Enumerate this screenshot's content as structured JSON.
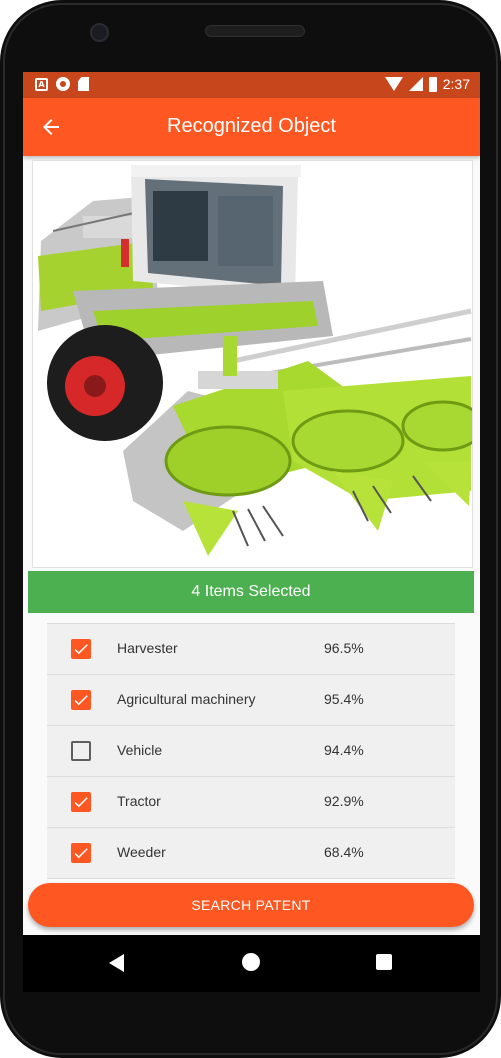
{
  "status_bar": {
    "time": "2:37",
    "icons": [
      "a-notification-icon",
      "record-icon",
      "sd-card-icon",
      "wifi-icon",
      "signal-icon",
      "battery-icon"
    ]
  },
  "app_bar": {
    "title": "Recognized Object",
    "back_icon": "arrow-left-icon"
  },
  "image": {
    "subject": "green and white forage harvester with corn header"
  },
  "selection_banner": {
    "text": "4 Items Selected",
    "color": "#4caf50"
  },
  "labels": [
    {
      "name": "Harvester",
      "score": "96.5%",
      "checked": true
    },
    {
      "name": "Agricultural machinery",
      "score": "95.4%",
      "checked": true
    },
    {
      "name": "Vehicle",
      "score": "94.4%",
      "checked": false
    },
    {
      "name": "Tractor",
      "score": "92.9%",
      "checked": true
    },
    {
      "name": "Weeder",
      "score": "68.4%",
      "checked": true
    }
  ],
  "search_button": {
    "label": "SEARCH PATENT"
  },
  "colors": {
    "primary": "#ff5722",
    "status_bar": "#c8461b",
    "success": "#4caf50"
  },
  "nav_bar": {
    "icons": [
      "nav-back-icon",
      "nav-home-icon",
      "nav-recent-apps-icon"
    ]
  }
}
